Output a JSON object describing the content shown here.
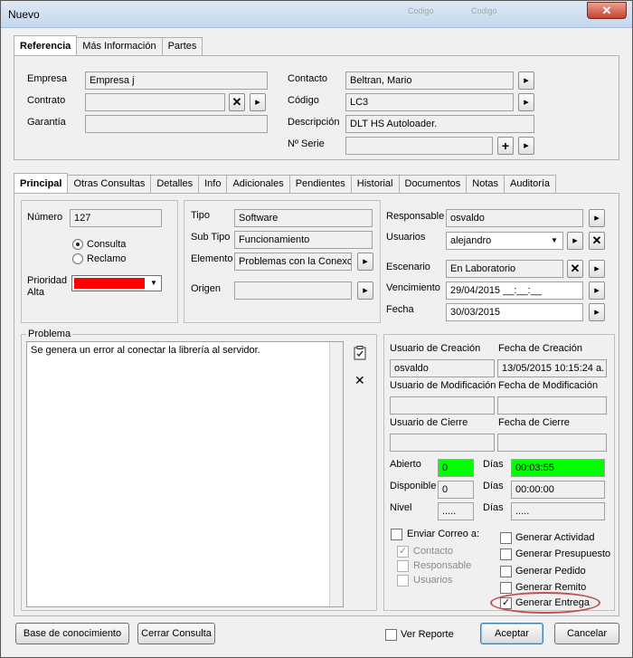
{
  "window": {
    "title": "Nuevo",
    "ghost_title_1": "Codigo",
    "ghost_title_2": "Codigo"
  },
  "ref_tabs": [
    "Referencia",
    "Más Información",
    "Partes"
  ],
  "ref": {
    "empresa_label": "Empresa",
    "empresa_value": "Empresa j",
    "contrato_label": "Contrato",
    "contrato_value": "",
    "garantia_label": "Garantía",
    "garantia_value": "",
    "contacto_label": "Contacto",
    "contacto_value": "Beltran, Mario",
    "codigo_label": "Código",
    "codigo_value": "LC3",
    "descripcion_label": "Descripción",
    "descripcion_value": "DLT HS Autoloader.",
    "serie_label": "Nº Serie",
    "serie_value": ""
  },
  "main_tabs": [
    "Principal",
    "Otras Consultas",
    "Detalles",
    "Info",
    "Adicionales",
    "Pendientes",
    "Historial",
    "Documentos",
    "Notas",
    "Auditoría"
  ],
  "left": {
    "numero_label": "Número",
    "numero_value": "127",
    "consulta_label": "Consulta",
    "reclamo_label": "Reclamo",
    "prioridad_label": "Prioridad",
    "prioridad_value": "Alta",
    "prioridad_color": "#ff0000"
  },
  "mid": {
    "tipo_label": "Tipo",
    "tipo_value": "Software",
    "subtipo_label": "Sub Tipo",
    "subtipo_value": "Funcionamiento",
    "elemento_label": "Elemento",
    "elemento_value": "Problemas con la Conexci",
    "origen_label": "Origen",
    "origen_value": ""
  },
  "right": {
    "responsable_label": "Responsable",
    "responsable_value": "osvaldo",
    "usuarios_label": "Usuarios",
    "usuarios_value": "alejandro",
    "escenario_label": "Escenario",
    "escenario_value": "En Laboratorio",
    "vencimiento_label": "Vencimiento",
    "vencimiento_value": "29/04/2015 __:__:__",
    "fecha_label": "Fecha",
    "fecha_value": "30/03/2015"
  },
  "problema": {
    "label": "Problema",
    "text": "Se genera un error al conectar la librería al servidor."
  },
  "info": {
    "usr_creacion_label": "Usuario de Creación",
    "usr_creacion_value": "osvaldo",
    "fecha_creacion_label": "Fecha de Creación",
    "fecha_creacion_value": "13/05/2015 10:15:24 a.",
    "usr_mod_label": "Usuario de Modificación",
    "usr_mod_value": "",
    "fecha_mod_label": "Fecha de Modificación",
    "fecha_mod_value": "",
    "usr_cierre_label": "Usuario de Cierre",
    "usr_cierre_value": "",
    "fecha_cierre_label": "Fecha de Cierre",
    "fecha_cierre_value": "",
    "abierto_label": "Abierto",
    "abierto_value": "0",
    "disponible_label": "Disponible",
    "disponible_value": "0",
    "nivel_label": "Nivel",
    "nivel_value": ".....",
    "dias_label": "Días",
    "dias_abierto_value": "00:03:55",
    "dias_disp_value": "00:00:00",
    "dias_nivel_value": ".....",
    "highlight_color": "#00ff00"
  },
  "email": {
    "enviar_label": "Enviar Correo a:",
    "contacto_label": "Contacto",
    "responsable_label": "Responsable",
    "usuarios_label": "Usuarios"
  },
  "generar": [
    "Generar Actividad",
    "Generar Presupuesto",
    "Generar Pedido",
    "Generar Remito",
    "Generar Entrega"
  ],
  "bottom": {
    "base_label": "Base de conocimiento",
    "cerrar_label": "Cerrar Consulta",
    "ver_reporte_label": "Ver Reporte",
    "aceptar_label": "Aceptar",
    "cancelar_label": "Cancelar"
  }
}
